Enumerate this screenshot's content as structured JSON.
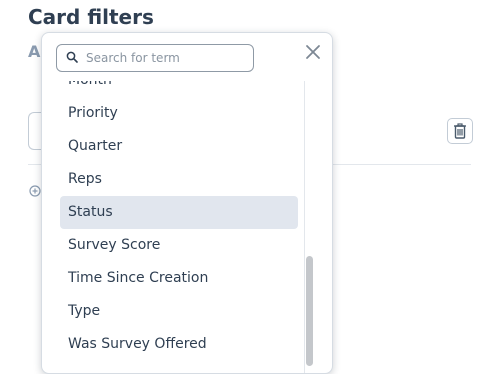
{
  "page": {
    "title": "Card filters",
    "sub_label": "A"
  },
  "search": {
    "placeholder": "Search for term",
    "value": ""
  },
  "options": {
    "items": [
      "Month",
      "Priority",
      "Quarter",
      "Reps",
      "Status",
      "Survey Score",
      "Time Since Creation",
      "Type",
      "Was Survey Offered"
    ],
    "selected": "Status"
  },
  "icons": {
    "search": "search-icon",
    "close": "close-icon",
    "trash": "trash-icon",
    "add": "add-circle-icon"
  },
  "colors": {
    "selected_bg": "#e1e6ee",
    "title": "#2f3f52",
    "muted": "#8a9bb0"
  }
}
